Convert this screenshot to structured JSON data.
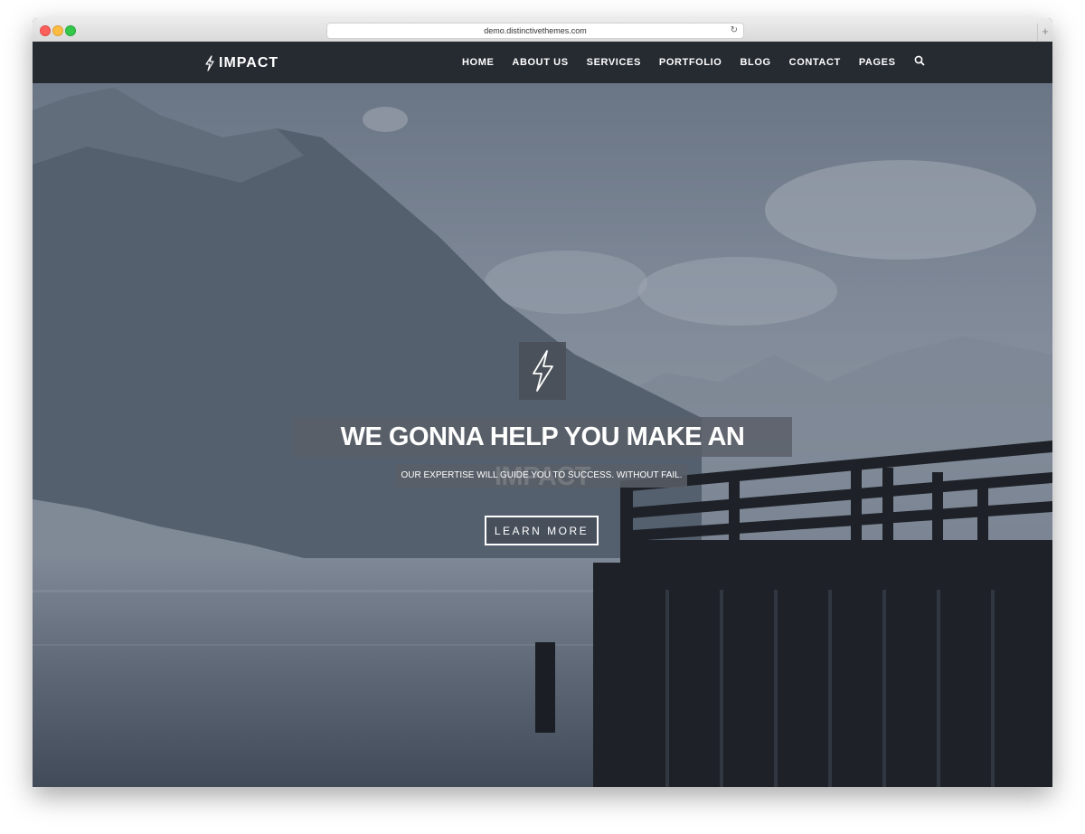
{
  "browser": {
    "url": "demo.distinctivethemes.com",
    "reload_icon": "reload-icon",
    "newtab_icon": "plus-icon"
  },
  "header": {
    "logo_text": "IMPACT",
    "logo_icon": "lightning-bolt-icon",
    "nav": [
      "HOME",
      "ABOUT US",
      "SERVICES",
      "PORTFOLIO",
      "BLOG",
      "CONTACT",
      "PAGES"
    ],
    "search_icon": "search-icon"
  },
  "hero": {
    "emblem_icon": "lightning-bolt-icon",
    "headline": "WE GONNA HELP YOU MAKE AN IMPACT",
    "subheadline": "OUR EXPERTISE WILL GUIDE YOU TO SUCCESS. WITHOUT FAIL.",
    "cta_label": "LEARN MORE"
  },
  "colors": {
    "navbar": "#262a31",
    "text": "#ffffff",
    "overlay": "#5a5f67"
  }
}
